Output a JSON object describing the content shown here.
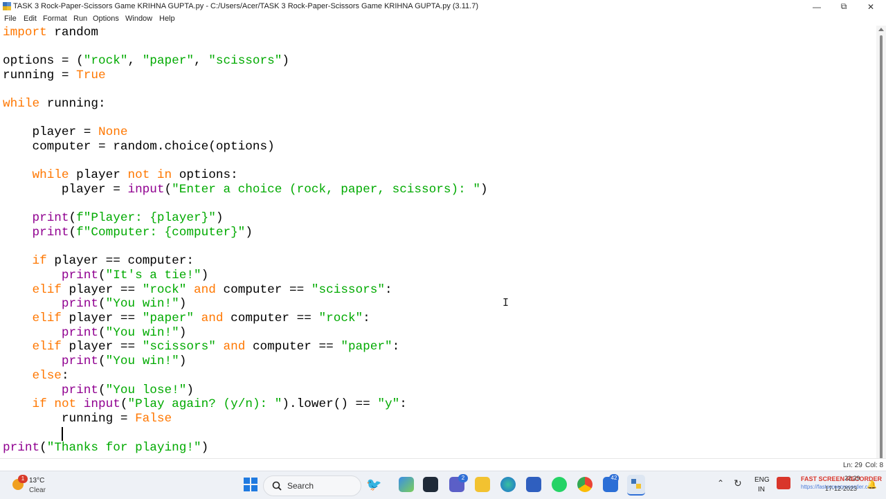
{
  "window": {
    "title": "TASK 3 Rock-Paper-Scissors Game  KRIHNA GUPTA.py - C:/Users/Acer/TASK 3 Rock-Paper-Scissors Game  KRIHNA GUPTA.py (3.11.7)",
    "minimize_icon": "minimize-icon",
    "maximize_icon": "restore-icon",
    "close_icon": "close-icon"
  },
  "menu": [
    "File",
    "Edit",
    "Format",
    "Run",
    "Options",
    "Window",
    "Help"
  ],
  "colors": {
    "keyword": "#ff7700",
    "builtin": "#900090",
    "string": "#00aa00",
    "text": "#000000"
  },
  "code": {
    "l1": {
      "a": "import",
      "b": " random"
    },
    "l3": {
      "a": "options = (",
      "b": "\"rock\"",
      "c": ", ",
      "d": "\"paper\"",
      "e": ", ",
      "f": "\"scissors\"",
      "g": ")"
    },
    "l4": {
      "a": "running = ",
      "b": "True"
    },
    "l6": {
      "a": "while",
      "b": " running:"
    },
    "l8": {
      "a": "    player = ",
      "b": "None"
    },
    "l9": {
      "a": "    computer = random.choice(options)"
    },
    "l11": {
      "a": "    ",
      "b": "while",
      "c": " player ",
      "d": "not in",
      "e": " options:"
    },
    "l12": {
      "a": "        player = ",
      "b": "input",
      "c": "(",
      "d": "\"Enter a choice (rock, paper, scissors): \"",
      "e": ")"
    },
    "l14": {
      "a": "    ",
      "b": "print",
      "c": "(",
      "d": "f\"Player: {player}\"",
      "e": ")"
    },
    "l15": {
      "a": "    ",
      "b": "print",
      "c": "(",
      "d": "f\"Computer: {computer}\"",
      "e": ")"
    },
    "l17": {
      "a": "    ",
      "b": "if",
      "c": " player == computer:"
    },
    "l18": {
      "a": "        ",
      "b": "print",
      "c": "(",
      "d": "\"It's a tie!\"",
      "e": ")"
    },
    "l19": {
      "a": "    ",
      "b": "elif",
      "c": " player == ",
      "d": "\"rock\"",
      "e": " ",
      "f": "and",
      "g": " computer == ",
      "h": "\"scissors\"",
      "i": ":"
    },
    "l20": {
      "a": "        ",
      "b": "print",
      "c": "(",
      "d": "\"You win!\"",
      "e": ")"
    },
    "l21": {
      "a": "    ",
      "b": "elif",
      "c": " player == ",
      "d": "\"paper\"",
      "e": " ",
      "f": "and",
      "g": " computer == ",
      "h": "\"rock\"",
      "i": ":"
    },
    "l22": {
      "a": "        ",
      "b": "print",
      "c": "(",
      "d": "\"You win!\"",
      "e": ")"
    },
    "l23": {
      "a": "    ",
      "b": "elif",
      "c": " player == ",
      "d": "\"scissors\"",
      "e": " ",
      "f": "and",
      "g": " computer == ",
      "h": "\"paper\"",
      "i": ":"
    },
    "l24": {
      "a": "        ",
      "b": "print",
      "c": "(",
      "d": "\"You win!\"",
      "e": ")"
    },
    "l25": {
      "a": "    ",
      "b": "else",
      "c": ":"
    },
    "l26": {
      "a": "        ",
      "b": "print",
      "c": "(",
      "d": "\"You lose!\"",
      "e": ")"
    },
    "l27": {
      "a": "    ",
      "b": "if",
      "c": " ",
      "d": "not",
      "e": " ",
      "f": "input",
      "g": "(",
      "h": "\"Play again? (y/n): \"",
      "i": ").lower() == ",
      "j": "\"y\"",
      "k": ":"
    },
    "l28": {
      "a": "        running = ",
      "b": "False"
    },
    "l30": {
      "a": "print",
      "b": "(",
      "c": "\"Thanks for playing!\"",
      "d": ")"
    }
  },
  "status": {
    "ln": "Ln: 29",
    "col": "Col: 8"
  },
  "taskbar": {
    "weather_temp": "13°C",
    "weather_desc": "Clear",
    "search_placeholder": "Search",
    "chat_badge": "2",
    "store_badge": "42",
    "lang_line1": "ENG",
    "lang_line2": "IN",
    "recorder_text": "FAST SCREEN RECORDER",
    "recorder_url": "https://fastscreenrecorder.com",
    "clock_time": "22:29",
    "clock_date": "17-12-2023",
    "weather_alert": "1"
  }
}
